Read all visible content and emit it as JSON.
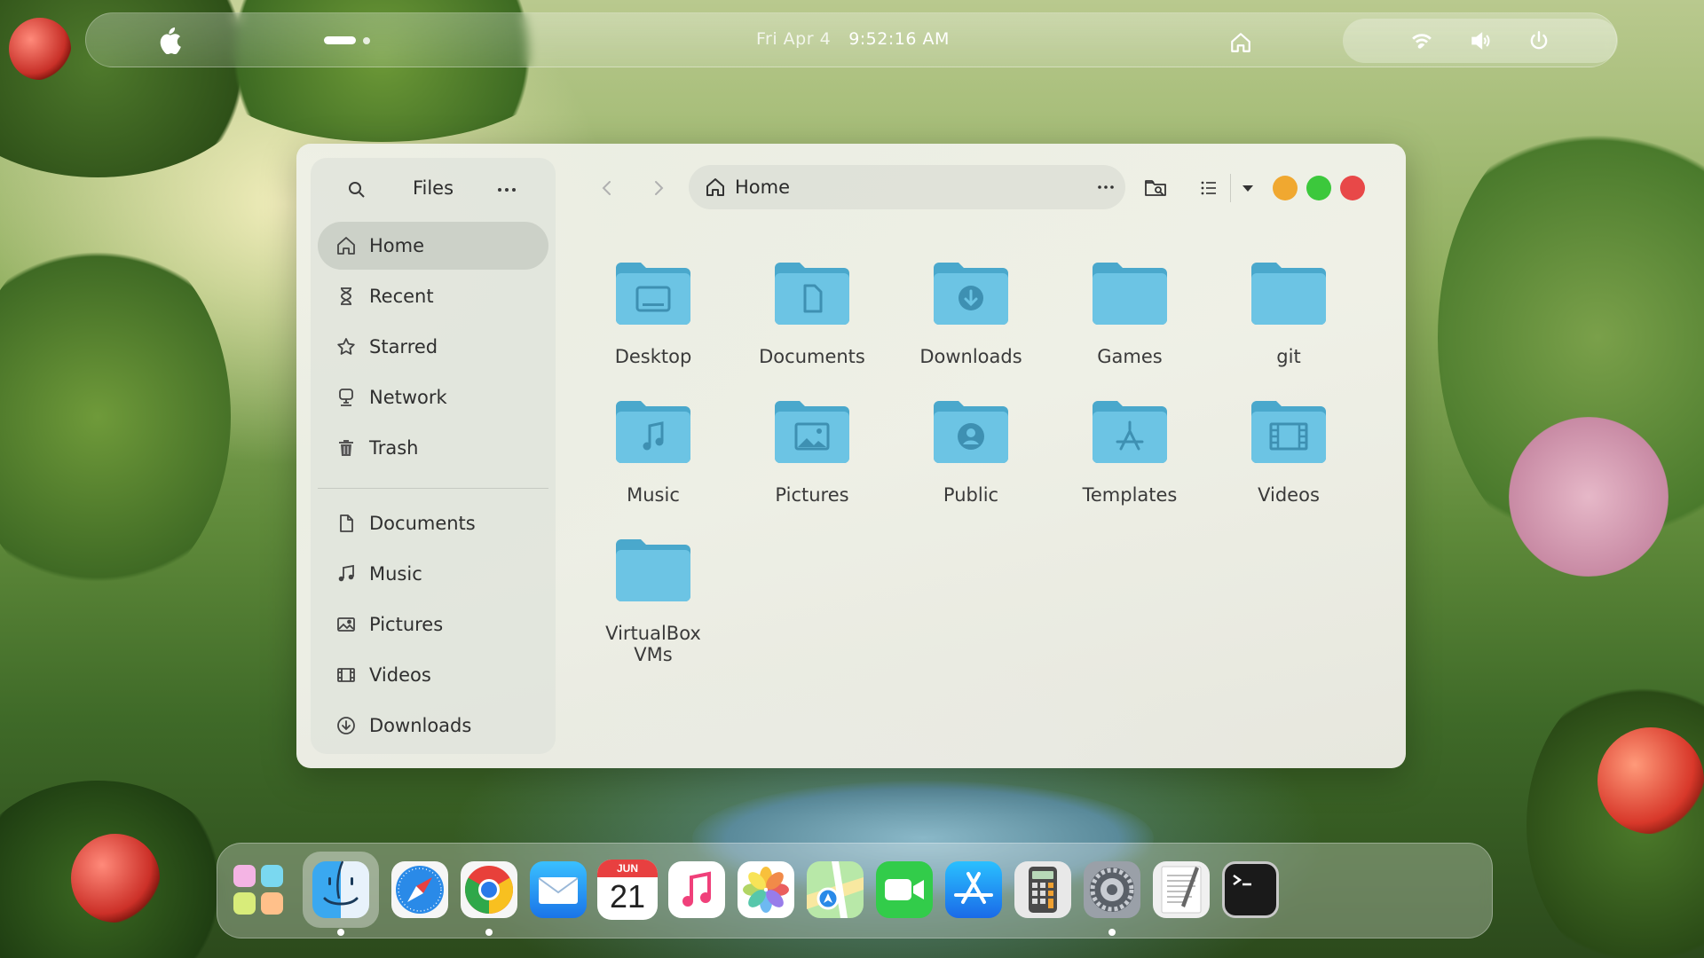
{
  "topbar": {
    "date": "Fri Apr 4",
    "time": "9:52:16 AM"
  },
  "window": {
    "sidebar": {
      "title": "Files",
      "items": [
        {
          "label": "Home",
          "icon": "home-icon",
          "active": true
        },
        {
          "label": "Recent",
          "icon": "recent-icon"
        },
        {
          "label": "Starred",
          "icon": "star-icon"
        },
        {
          "label": "Network",
          "icon": "network-icon"
        },
        {
          "label": "Trash",
          "icon": "trash-icon"
        }
      ],
      "bookmarks": [
        {
          "label": "Documents",
          "icon": "document-icon"
        },
        {
          "label": "Music",
          "icon": "music-icon"
        },
        {
          "label": "Pictures",
          "icon": "picture-icon"
        },
        {
          "label": "Videos",
          "icon": "video-icon"
        },
        {
          "label": "Downloads",
          "icon": "download-icon"
        }
      ]
    },
    "pathbar": {
      "label": "Home"
    },
    "files": [
      {
        "name": "Desktop",
        "emblem": "desktop"
      },
      {
        "name": "Documents",
        "emblem": "document"
      },
      {
        "name": "Downloads",
        "emblem": "download"
      },
      {
        "name": "Games",
        "emblem": "none"
      },
      {
        "name": "git",
        "emblem": "none"
      },
      {
        "name": "Music",
        "emblem": "music"
      },
      {
        "name": "Pictures",
        "emblem": "picture"
      },
      {
        "name": "Public",
        "emblem": "user"
      },
      {
        "name": "Templates",
        "emblem": "template"
      },
      {
        "name": "Videos",
        "emblem": "video"
      },
      {
        "name": "VirtualBox VMs",
        "emblem": "none"
      }
    ],
    "colors": {
      "minimize": "#f0a830",
      "maximize": "#3cc83c",
      "close": "#e84848",
      "folder": "#6cc4e4"
    }
  },
  "dock": {
    "apps": [
      {
        "name": "launchpad",
        "running": false
      },
      {
        "name": "finder",
        "running": true
      },
      {
        "name": "safari",
        "running": false
      },
      {
        "name": "chrome",
        "running": true
      },
      {
        "name": "mail",
        "running": false
      },
      {
        "name": "calendar",
        "running": false,
        "month": "JUN",
        "day": "21"
      },
      {
        "name": "music",
        "running": false
      },
      {
        "name": "photos",
        "running": false
      },
      {
        "name": "maps",
        "running": false
      },
      {
        "name": "facetime",
        "running": false
      },
      {
        "name": "app-store",
        "running": false
      },
      {
        "name": "calculator",
        "running": false
      },
      {
        "name": "system-settings",
        "running": true
      },
      {
        "name": "textedit",
        "running": false
      },
      {
        "name": "terminal",
        "running": false
      }
    ]
  }
}
